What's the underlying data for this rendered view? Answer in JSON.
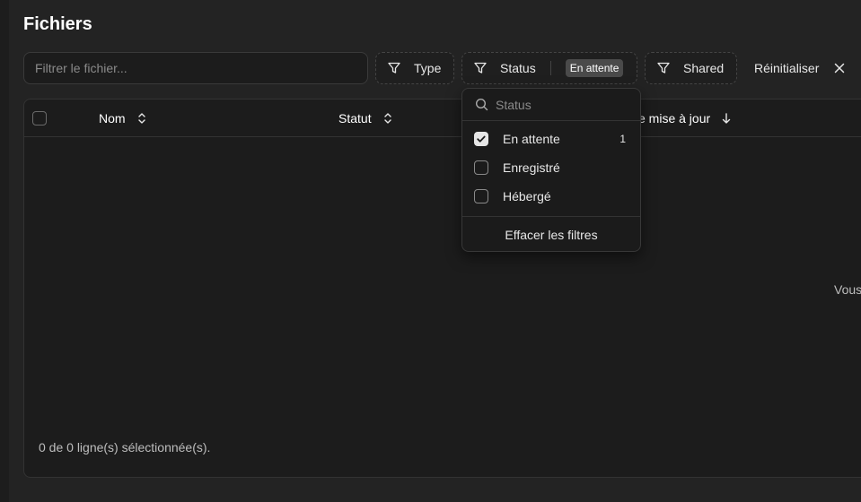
{
  "page": {
    "title": "Fichiers"
  },
  "search": {
    "placeholder": "Filtrer le fichier..."
  },
  "filters": {
    "type_label": "Type",
    "status_label": "Status",
    "status_badge": "En attente",
    "shared_label": "Shared",
    "reset_label": "Réinitialiser"
  },
  "table": {
    "columns": [
      "Nom",
      "Statut",
      "e mise à jour"
    ],
    "empty_message": "Vous",
    "footer": "0 de 0 ligne(s) sélectionnée(s)."
  },
  "status_dropdown": {
    "search_placeholder": "Status",
    "options": [
      {
        "label": "En attente",
        "checked": true,
        "count": "1"
      },
      {
        "label": "Enregistré",
        "checked": false,
        "count": ""
      },
      {
        "label": "Hébergé",
        "checked": false,
        "count": ""
      }
    ],
    "clear_label": "Effacer les filtres"
  },
  "icons": [
    "filter-icon",
    "close-icon",
    "sort-icon",
    "arrow-down-icon",
    "search-icon",
    "check-icon"
  ]
}
